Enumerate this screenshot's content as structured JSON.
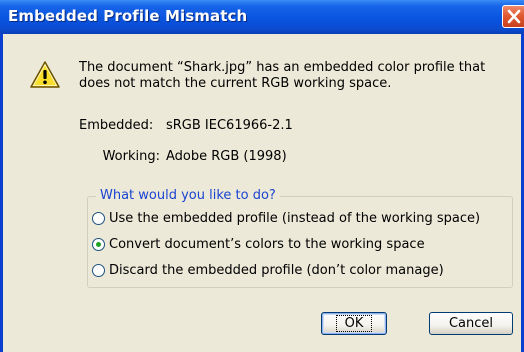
{
  "dialog": {
    "title": "Embedded Profile Mismatch",
    "message": "The document “Shark.jpg” has an embedded color profile that does not match the current RGB working space.",
    "embedded_label": "Embedded:",
    "embedded_value": "sRGB IEC61966-2.1",
    "working_label": "Working:",
    "working_value": "Adobe RGB (1998)",
    "group_title": "What would you like to do?",
    "options": [
      {
        "label": "Use the embedded profile (instead of the working space)",
        "selected": false
      },
      {
        "label": "Convert document’s colors to the working space",
        "selected": true
      },
      {
        "label": "Discard the embedded profile (don’t color manage)",
        "selected": false
      }
    ],
    "ok_label": "OK",
    "cancel_label": "Cancel"
  },
  "icons": {
    "warning": "warning-icon",
    "close": "close-icon"
  },
  "colors": {
    "titlebar": "#0a55e0",
    "client_bg": "#ece9d8",
    "group_title": "#1a44d2",
    "radio_dot": "#21a121",
    "close_button": "#e05a32"
  }
}
